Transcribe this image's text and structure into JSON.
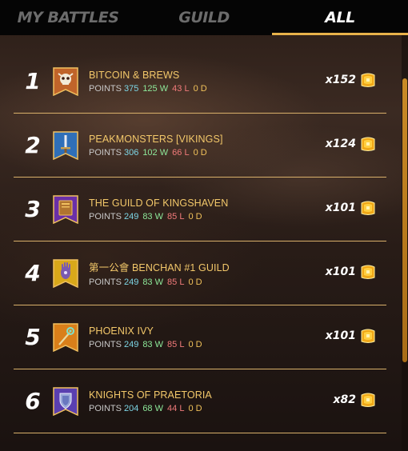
{
  "tabs": [
    {
      "label": "MY BATTLES",
      "active": false
    },
    {
      "label": "GUILD",
      "active": false
    },
    {
      "label": "ALL",
      "active": true
    }
  ],
  "stats_labels": {
    "points": "POINTS",
    "wins_suffix": "W",
    "losses_suffix": "L",
    "draws_suffix": "D"
  },
  "guilds": [
    {
      "rank": "1",
      "name": "BITCOIN & BREWS",
      "points": "375",
      "wins": "125",
      "losses": "43",
      "draws": "0",
      "reward": "x152",
      "emblem": "skull-icon",
      "banner_color": "#c0642a"
    },
    {
      "rank": "2",
      "name": "PEAKMONSTERS [VIKINGS]",
      "points": "306",
      "wins": "102",
      "losses": "66",
      "draws": "0",
      "reward": "x124",
      "emblem": "sword-icon",
      "banner_color": "#2f6fb8"
    },
    {
      "rank": "3",
      "name": "THE GUILD OF KINGSHAVEN",
      "points": "249",
      "wins": "83",
      "losses": "85",
      "draws": "0",
      "reward": "x101",
      "emblem": "book-icon",
      "banner_color": "#6a2fa8"
    },
    {
      "rank": "4",
      "name": "第一公會 BENCHAN #1 GUILD",
      "points": "249",
      "wins": "83",
      "losses": "85",
      "draws": "0",
      "reward": "x101",
      "emblem": "hand-icon",
      "banner_color": "#d9a81a"
    },
    {
      "rank": "5",
      "name": "PHOENIX IVY",
      "points": "249",
      "wins": "83",
      "losses": "85",
      "draws": "0",
      "reward": "x101",
      "emblem": "staff-icon",
      "banner_color": "#d97f1a"
    },
    {
      "rank": "6",
      "name": "KNIGHTS OF PRAETORIA",
      "points": "204",
      "wins": "68",
      "losses": "44",
      "draws": "0",
      "reward": "x82",
      "emblem": "shield-icon",
      "banner_color": "#5a3fb0"
    }
  ],
  "reward_icon": "reward-crate-icon",
  "colors": {
    "accent": "#e8b24a",
    "name": "#f3c86a",
    "points": "#7dd6e6",
    "wins": "#8de89a",
    "losses": "#f07a7a",
    "draws": "#f0c15a"
  }
}
